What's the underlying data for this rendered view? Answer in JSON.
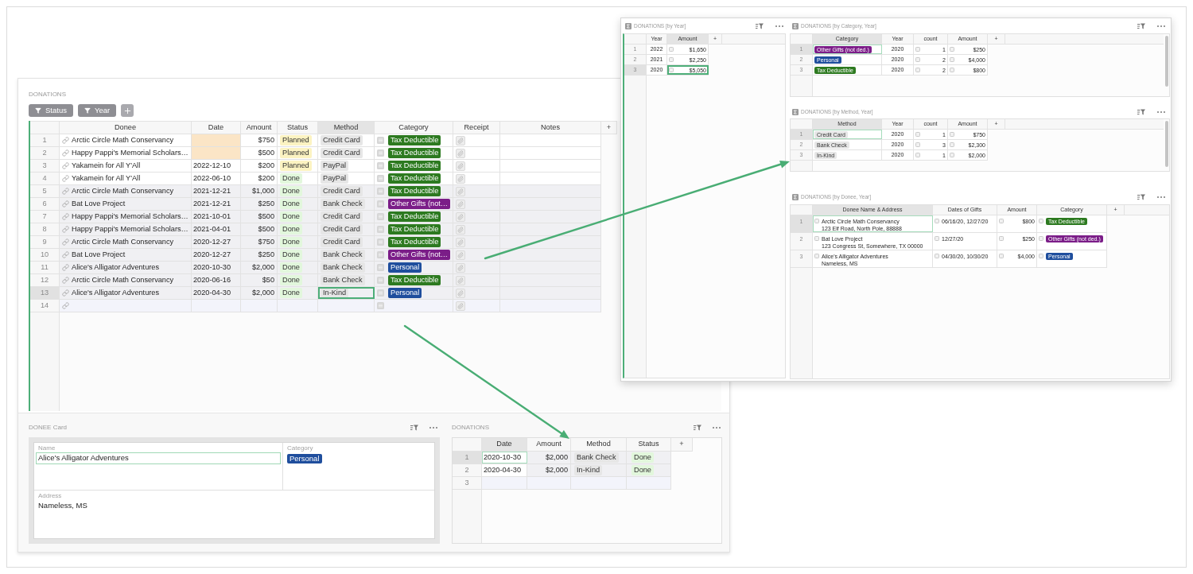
{
  "main_window": {
    "donations": {
      "title": "DONATIONS",
      "active": true,
      "filters": [
        {
          "label": "Status"
        },
        {
          "label": "Year"
        }
      ],
      "columns": [
        {
          "label": "Donee",
          "selected": false
        },
        {
          "label": "Date",
          "selected": false
        },
        {
          "label": "Amount",
          "selected": false
        },
        {
          "label": "Status",
          "selected": false
        },
        {
          "label": "Method",
          "selected": true
        },
        {
          "label": "Category",
          "selected": false
        },
        {
          "label": "Receipt",
          "selected": false
        },
        {
          "label": "Notes",
          "selected": false
        }
      ],
      "add_column": "+",
      "rows": [
        {
          "n": "1",
          "kind": "record",
          "selected": false,
          "shaded": false,
          "donee": "Arctic Circle Math Conservancy",
          "date_flagged": true,
          "amount": "$750",
          "status": {
            "label": "Planned",
            "color": "#fcf3c2"
          },
          "method": "Credit Card",
          "category": {
            "label": "Tax Deductible",
            "color": "#2d7a20"
          }
        },
        {
          "n": "2",
          "kind": "record",
          "selected": false,
          "shaded": false,
          "donee": "Happy Pappi's Memorial Scholars…",
          "date_flagged": true,
          "amount": "$500",
          "status": {
            "label": "Planned",
            "color": "#fcf3c2"
          },
          "method": "Credit Card",
          "category": {
            "label": "Tax Deductible",
            "color": "#2d7a20"
          }
        },
        {
          "n": "3",
          "kind": "record",
          "selected": false,
          "shaded": false,
          "donee": "Yakamein for All Y'All",
          "date": "2022-12-10",
          "date_flagged": false,
          "amount": "$200",
          "status": {
            "label": "Planned",
            "color": "#fcf3c2"
          },
          "method": "PayPal",
          "category": {
            "label": "Tax Deductible",
            "color": "#2d7a20"
          }
        },
        {
          "n": "4",
          "kind": "record",
          "selected": false,
          "shaded": false,
          "donee": "Yakamein for All Y'All",
          "date": "2022-06-10",
          "date_flagged": false,
          "amount": "$200",
          "status": {
            "label": "Done",
            "color": "#e2f7dc"
          },
          "method": "PayPal",
          "category": {
            "label": "Tax Deductible",
            "color": "#2d7a20"
          }
        },
        {
          "n": "5",
          "kind": "record",
          "selected": false,
          "shaded": true,
          "donee": "Arctic Circle Math Conservancy",
          "date": "2021-12-21",
          "date_flagged": false,
          "amount": "$1,000",
          "status": {
            "label": "Done",
            "color": "#e2f7dc"
          },
          "method": "Credit Card",
          "category": {
            "label": "Tax Deductible",
            "color": "#2d7a20"
          }
        },
        {
          "n": "6",
          "kind": "record",
          "selected": false,
          "shaded": true,
          "donee": "Bat Love Project",
          "date": "2021-12-21",
          "date_flagged": false,
          "amount": "$250",
          "status": {
            "label": "Done",
            "color": "#e2f7dc"
          },
          "method": "Bank Check",
          "category": {
            "label": "Other Gifts (not…",
            "color": "#7b1d88"
          }
        },
        {
          "n": "7",
          "kind": "record",
          "selected": false,
          "shaded": true,
          "donee": "Happy Pappi's Memorial Scholars…",
          "date": "2021-10-01",
          "date_flagged": false,
          "amount": "$500",
          "status": {
            "label": "Done",
            "color": "#e2f7dc"
          },
          "method": "Credit Card",
          "category": {
            "label": "Tax Deductible",
            "color": "#2d7a20"
          }
        },
        {
          "n": "8",
          "kind": "record",
          "selected": false,
          "shaded": true,
          "donee": "Happy Pappi's Memorial Scholars…",
          "date": "2021-04-01",
          "date_flagged": false,
          "amount": "$500",
          "status": {
            "label": "Done",
            "color": "#e2f7dc"
          },
          "method": "Credit Card",
          "category": {
            "label": "Tax Deductible",
            "color": "#2d7a20"
          }
        },
        {
          "n": "9",
          "kind": "record",
          "selected": false,
          "shaded": true,
          "donee": "Arctic Circle Math Conservancy",
          "date": "2020-12-27",
          "date_flagged": false,
          "amount": "$750",
          "status": {
            "label": "Done",
            "color": "#e2f7dc"
          },
          "method": "Credit Card",
          "category": {
            "label": "Tax Deductible",
            "color": "#2d7a20"
          }
        },
        {
          "n": "10",
          "kind": "record",
          "selected": false,
          "shaded": true,
          "donee": "Bat Love Project",
          "date": "2020-12-27",
          "date_flagged": false,
          "amount": "$250",
          "status": {
            "label": "Done",
            "color": "#e2f7dc"
          },
          "method": "Bank Check",
          "category": {
            "label": "Other Gifts (not…",
            "color": "#7b1d88"
          }
        },
        {
          "n": "11",
          "kind": "record",
          "selected": false,
          "shaded": true,
          "donee": "Alice's Alligator Adventures",
          "date": "2020-10-30",
          "date_flagged": false,
          "amount": "$2,000",
          "status": {
            "label": "Done",
            "color": "#e2f7dc"
          },
          "method": "Bank Check",
          "category": {
            "label": "Personal",
            "color": "#1f4e9d"
          }
        },
        {
          "n": "12",
          "kind": "record",
          "selected": false,
          "shaded": true,
          "donee": "Arctic Circle Math Conservancy",
          "date": "2020-06-16",
          "date_flagged": false,
          "amount": "$50",
          "status": {
            "label": "Done",
            "color": "#e2f7dc"
          },
          "method": "Bank Check",
          "category": {
            "label": "Tax Deductible",
            "color": "#2d7a20"
          }
        },
        {
          "n": "13",
          "kind": "record",
          "selected": true,
          "shaded": true,
          "donee": "Alice's Alligator Adventures",
          "date": "2020-04-30",
          "date_flagged": false,
          "amount": "$2,000",
          "status": {
            "label": "Done",
            "color": "#e2f7dc"
          },
          "method": "In-Kind",
          "category": {
            "label": "Personal",
            "color": "#1f4e9d"
          }
        },
        {
          "n": "14",
          "kind": "new",
          "selected": false
        }
      ]
    },
    "donee_card": {
      "title": "DONEE Card",
      "fields": [
        {
          "kind": "text",
          "label": "Name",
          "value": "Alice's Alligator Adventures",
          "selected": true
        },
        {
          "kind": "tag",
          "label": "Category",
          "tag": {
            "label": "Personal",
            "color": "#1f4e9d"
          },
          "selected": false
        },
        {
          "kind": "text",
          "label": "Address",
          "value": "Nameless, MS",
          "selected": false
        }
      ]
    },
    "donee_donations": {
      "title": "DONATIONS",
      "active": false,
      "columns": [
        {
          "label": "Date",
          "selected": true
        },
        {
          "label": "Amount",
          "selected": false
        },
        {
          "label": "Method",
          "selected": false
        },
        {
          "label": "Status",
          "selected": false
        }
      ],
      "add_column": "+",
      "rows": [
        {
          "n": "1",
          "kind": "record",
          "selected": true,
          "shaded": true,
          "date": "2020-10-30",
          "amount": "$2,000",
          "method": "Bank Check",
          "status": {
            "label": "Done",
            "color": "#e2f7dc"
          }
        },
        {
          "n": "2",
          "kind": "record",
          "selected": false,
          "shaded": true,
          "date": "2020-04-30",
          "amount": "$2,000",
          "method": "In-Kind",
          "status": {
            "label": "Done",
            "color": "#e2f7dc"
          }
        },
        {
          "n": "3",
          "kind": "new",
          "selected": false
        }
      ]
    }
  },
  "summary_window": {
    "by_year": {
      "title": "DONATIONS [by Year]",
      "active": true,
      "columns": [
        {
          "label": "Year",
          "kind": "plain",
          "selected": false
        },
        {
          "label": "Amount",
          "kind": "number",
          "selected": true
        }
      ],
      "add_column": "+",
      "rows": [
        {
          "n": "1",
          "selected": false,
          "cells": [
            "2022",
            "$1,650"
          ]
        },
        {
          "n": "2",
          "selected": false,
          "cells": [
            "2021",
            "$2,250"
          ]
        },
        {
          "n": "3",
          "selected": true,
          "cells": [
            "2020",
            "$5,050"
          ]
        }
      ]
    },
    "by_category": {
      "title": "DONATIONS [by Category, Year]",
      "active": false,
      "columns": [
        {
          "label": "Category",
          "kind": "tag",
          "selected": true
        },
        {
          "label": "Year",
          "kind": "plain",
          "selected": false
        },
        {
          "label": "count",
          "kind": "number",
          "selected": false
        },
        {
          "label": "Amount",
          "kind": "number",
          "selected": false
        }
      ],
      "add_column": "+",
      "rows": [
        {
          "n": "1",
          "selected": true,
          "cells": [
            {
              "label": "Other Gifts (not ded.)",
              "color": "#7b1d88"
            },
            "2020",
            "1",
            "$250"
          ]
        },
        {
          "n": "2",
          "selected": false,
          "cells": [
            {
              "label": "Personal",
              "color": "#1f4e9d"
            },
            "2020",
            "2",
            "$4,000"
          ]
        },
        {
          "n": "3",
          "selected": false,
          "cells": [
            {
              "label": "Tax Deductible",
              "color": "#2d7a20"
            },
            "2020",
            "2",
            "$800"
          ]
        }
      ]
    },
    "by_method": {
      "title": "DONATIONS [by Method, Year]",
      "active": false,
      "columns": [
        {
          "label": "Method",
          "kind": "chip",
          "selected": true
        },
        {
          "label": "Year",
          "kind": "plain",
          "selected": false
        },
        {
          "label": "count",
          "kind": "number",
          "selected": false
        },
        {
          "label": "Amount",
          "kind": "number",
          "selected": false
        }
      ],
      "add_column": "+",
      "rows": [
        {
          "n": "1",
          "selected": true,
          "cells": [
            "Credit Card",
            "2020",
            "1",
            "$750"
          ]
        },
        {
          "n": "2",
          "selected": false,
          "cells": [
            "Bank Check",
            "2020",
            "3",
            "$2,300"
          ]
        },
        {
          "n": "3",
          "selected": false,
          "cells": [
            "In-Kind",
            "2020",
            "1",
            "$2,000"
          ]
        }
      ]
    },
    "by_donee": {
      "title": "DONATIONS [by Donee, Year]",
      "active": false,
      "columns": [
        {
          "label": "Donee Name & Address",
          "kind": "address",
          "selected": true
        },
        {
          "label": "Dates of Gifts",
          "kind": "list",
          "selected": false
        },
        {
          "label": "Amount",
          "kind": "number",
          "selected": false
        },
        {
          "label": "Category",
          "kind": "marked-tag",
          "selected": false
        }
      ],
      "add_column": "+",
      "rows": [
        {
          "n": "1",
          "selected": true,
          "cells": [
            {
              "name": "Arctic Circle Math Conservancy",
              "address": "123 Elf Road, North Pole, 88888"
            },
            "06/16/20, 12/27/20",
            "$800",
            {
              "label": "Tax Deductible",
              "color": "#2d7a20"
            }
          ]
        },
        {
          "n": "2",
          "selected": false,
          "cells": [
            {
              "name": "Bat Love Project",
              "address": "123 Congress St, Somewhere, TX 00000"
            },
            "12/27/20",
            "$250",
            {
              "label": "Other Gifts (not ded.)",
              "color": "#7b1d88"
            }
          ]
        },
        {
          "n": "3",
          "selected": false,
          "cells": [
            {
              "name": "Alice's Alligator Adventures",
              "address": "Nameless, MS"
            },
            "04/30/20, 10/30/20",
            "$4,000",
            {
              "label": "Personal",
              "color": "#1f4e9d"
            }
          ]
        }
      ]
    }
  }
}
